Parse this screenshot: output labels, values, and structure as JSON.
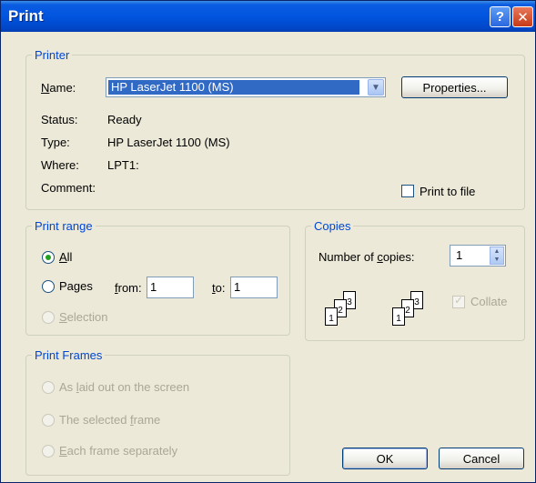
{
  "window": {
    "title": "Print",
    "help_glyph": "?",
    "close_glyph": "✕"
  },
  "printer": {
    "legend": "Printer",
    "name_label": "Name:",
    "name_value": "HP LaserJet 1100 (MS)",
    "properties_label": "Properties...",
    "status_label": "Status:",
    "status_value": "Ready",
    "type_label": "Type:",
    "type_value": "HP LaserJet 1100 (MS)",
    "where_label": "Where:",
    "where_value": "LPT1:",
    "comment_label": "Comment:",
    "print_to_file_label": "Print to file",
    "print_to_file_checked": false
  },
  "print_range": {
    "legend": "Print range",
    "all_label": "All",
    "pages_label": "Pages",
    "from_label": "from:",
    "from_value": "1",
    "to_label": "to:",
    "to_value": "1",
    "selection_label": "Selection",
    "selected": "all"
  },
  "copies": {
    "legend": "Copies",
    "number_label": "Number of copies:",
    "number_value": "1",
    "collate_label": "Collate",
    "collate_checked": true,
    "collate_disabled": true,
    "page_numbers": [
      "1",
      "2",
      "3"
    ]
  },
  "print_frames": {
    "legend": "Print Frames",
    "options": [
      "As laid out on the screen",
      "The selected frame",
      "Each frame separately"
    ]
  },
  "buttons": {
    "ok": "OK",
    "cancel": "Cancel"
  },
  "colors": {
    "title_bar": "#0155df",
    "group_legend": "#0046d5",
    "dialog_bg": "#ece9d8",
    "selection": "#316ac5"
  }
}
